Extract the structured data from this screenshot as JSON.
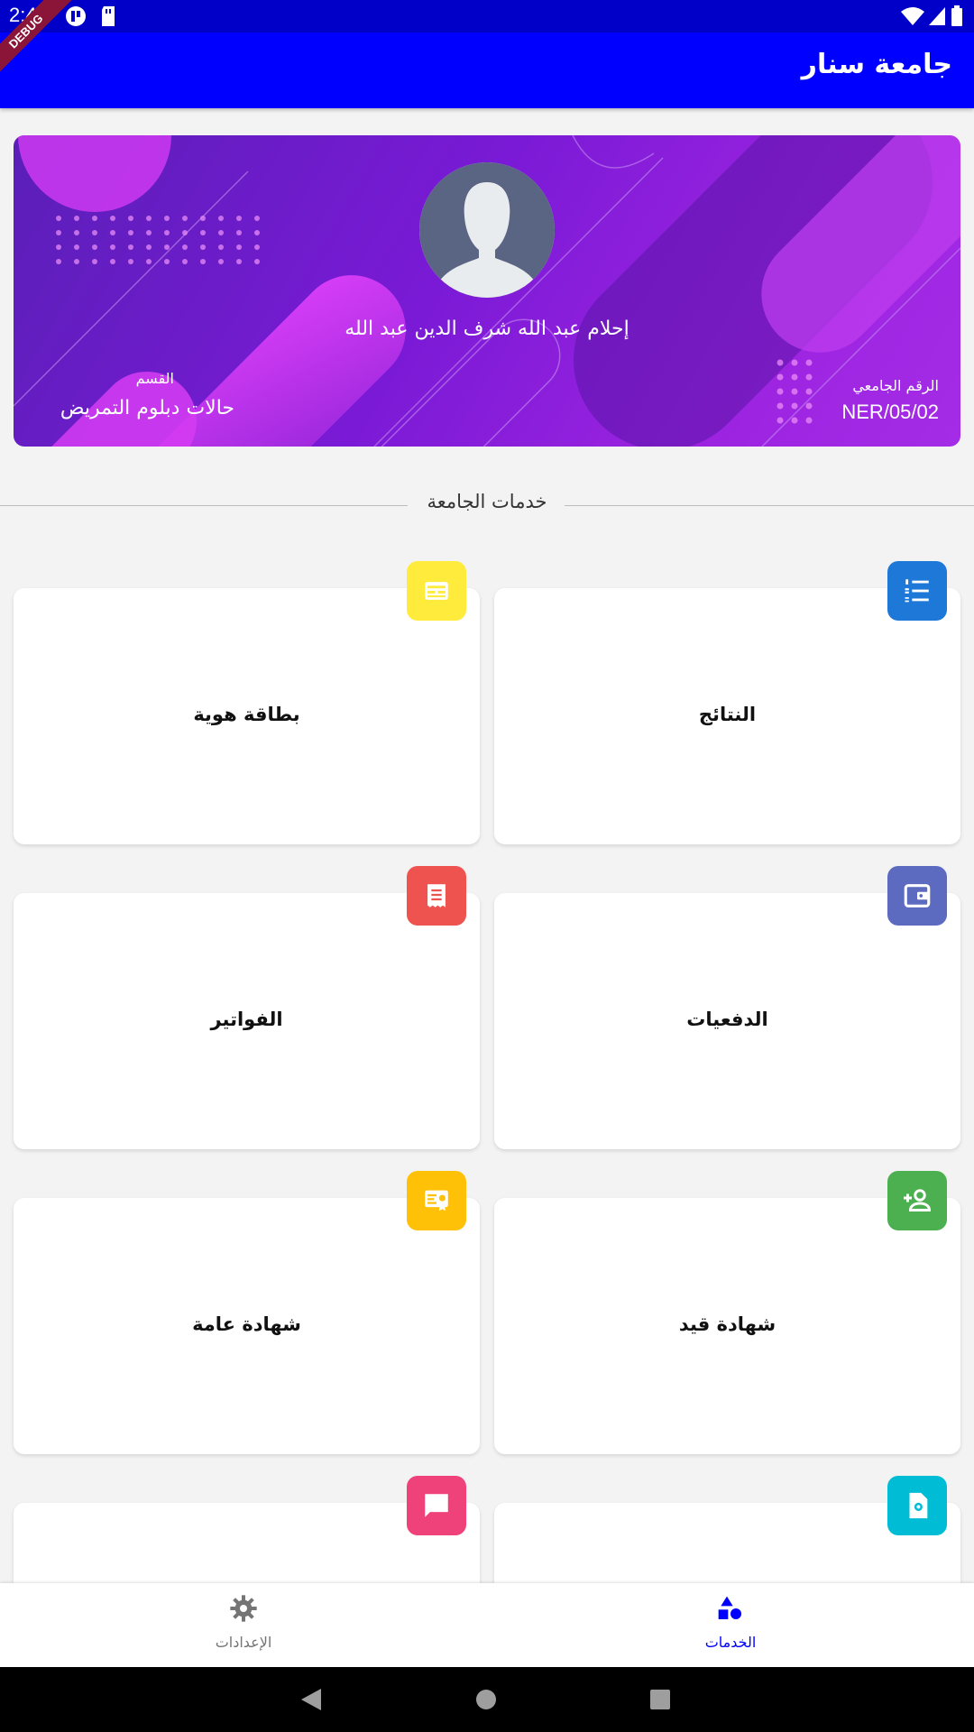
{
  "status_bar": {
    "time": "2:49",
    "debug_label": "DEBUG"
  },
  "app_bar": {
    "title": "جامعة سنار"
  },
  "profile": {
    "name": "إحلام عبد الله شرف الدين عبد الله",
    "department_label": "القسم",
    "department_value": "حالات دبلوم التمريض",
    "student_id_label": "الرقم الجامعي",
    "student_id_value": "NER/05/02"
  },
  "services_section": {
    "title": "خدمات الجامعة"
  },
  "services": [
    {
      "label": "النتائج",
      "icon": "list-numbered-icon",
      "color": "#1e78d8"
    },
    {
      "label": "بطاقة هوية",
      "icon": "id-card-icon",
      "color": "#ffeb3b"
    },
    {
      "label": "الدفعيات",
      "icon": "wallet-icon",
      "color": "#5c6bc0"
    },
    {
      "label": "الفواتير",
      "icon": "receipt-icon",
      "color": "#ef5350"
    },
    {
      "label": "شهادة قيد",
      "icon": "person-add-icon",
      "color": "#4caf50"
    },
    {
      "label": "شهادة عامة",
      "icon": "certificate-icon",
      "color": "#ffc107"
    },
    {
      "label": "",
      "icon": "document-badge-icon",
      "color": "#00bcd4"
    },
    {
      "label": "",
      "icon": "message-icon",
      "color": "#f0427a"
    }
  ],
  "bottom_nav": {
    "services": {
      "label": "الخدمات",
      "icon": "shapes-icon",
      "color": "#0000ff"
    },
    "settings": {
      "label": "الإعدادات",
      "icon": "gear-icon",
      "color": "#757575"
    }
  }
}
